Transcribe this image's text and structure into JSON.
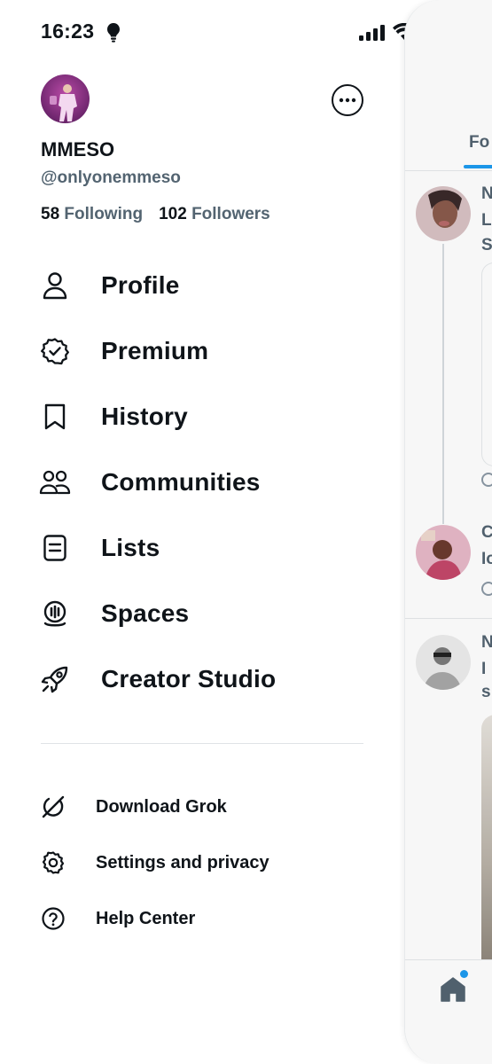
{
  "status_bar": {
    "time": "16:23"
  },
  "profile": {
    "display_name": "MMESO",
    "handle": "@onlyonemmeso",
    "following_count": "58",
    "following_label": "Following",
    "followers_count": "102",
    "followers_label": "Followers"
  },
  "menu": [
    {
      "label": "Profile",
      "icon": "person-icon"
    },
    {
      "label": "Premium",
      "icon": "verified-badge-icon"
    },
    {
      "label": "History",
      "icon": "bookmark-icon"
    },
    {
      "label": "Communities",
      "icon": "people-icon"
    },
    {
      "label": "Lists",
      "icon": "list-icon"
    },
    {
      "label": "Spaces",
      "icon": "microphone-icon"
    },
    {
      "label": "Creator Studio",
      "icon": "rocket-icon"
    }
  ],
  "secondary_menu": [
    {
      "label": "Download Grok",
      "icon": "grok-icon"
    },
    {
      "label": "Settings and privacy",
      "icon": "gear-icon"
    },
    {
      "label": "Help Center",
      "icon": "help-icon"
    }
  ],
  "timeline": {
    "tab_partial": "Fo",
    "post_initials": [
      "N",
      "L",
      "S",
      "C",
      "Io",
      "N",
      "I",
      "s"
    ]
  },
  "colors": {
    "accent": "#1d9bf0",
    "text_primary": "#0f1419",
    "text_secondary": "#536471",
    "battery_charging": "#34c759"
  }
}
